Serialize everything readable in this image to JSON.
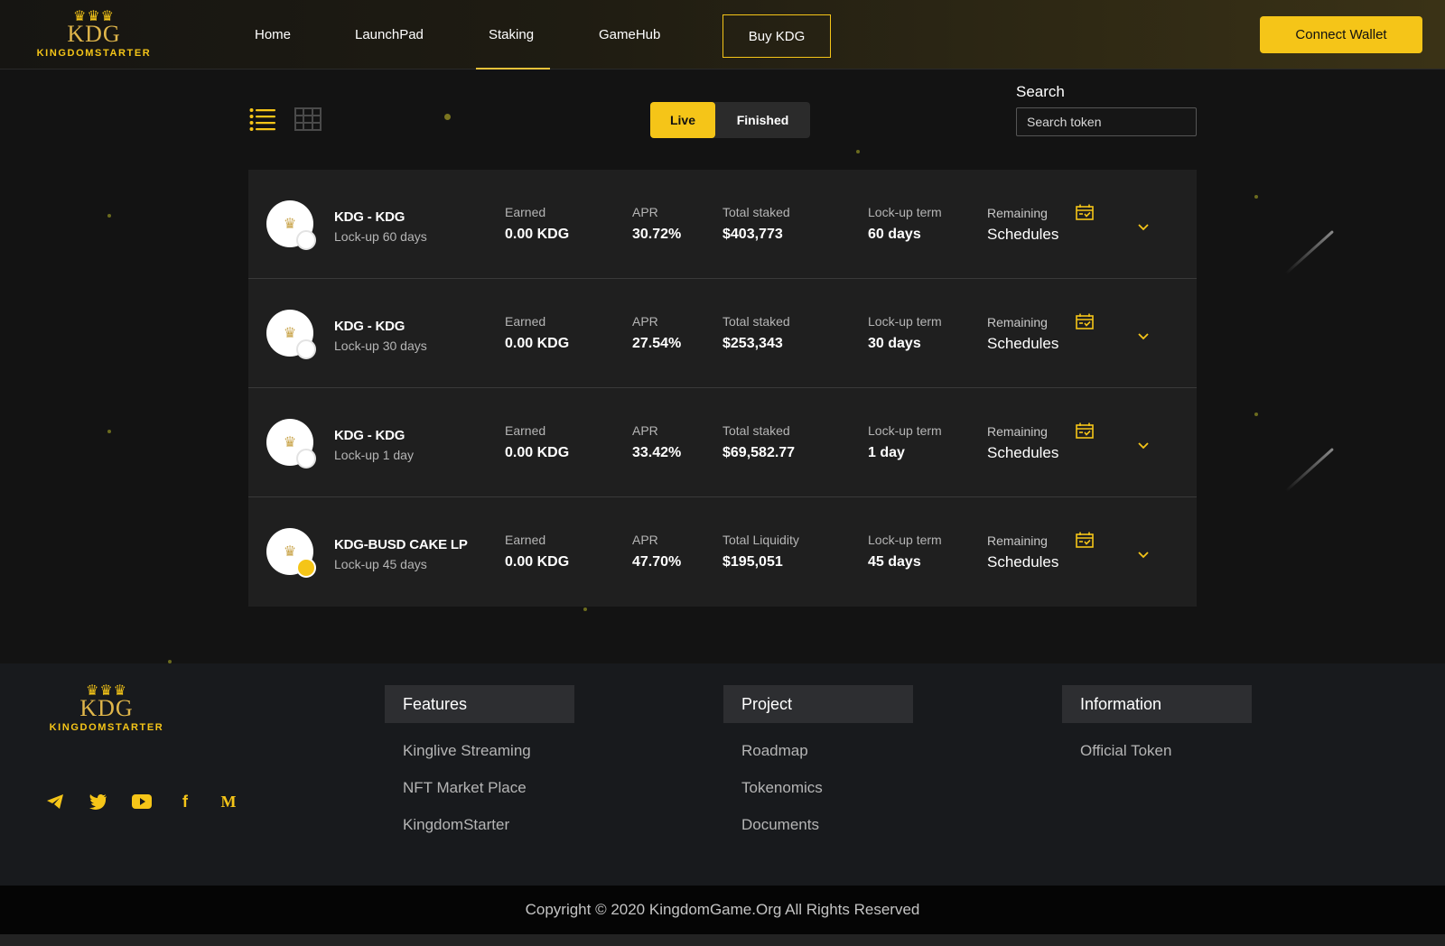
{
  "brand": {
    "logo_mark": "KDG",
    "logo_word": "KINGDOMSTARTER"
  },
  "nav": {
    "items": [
      "Home",
      "LaunchPad",
      "Staking",
      "GameHub"
    ],
    "active": "Staking",
    "buy_label": "Buy KDG",
    "connect_label": "Connect Wallet"
  },
  "toolbar": {
    "live_label": "Live",
    "finished_label": "Finished",
    "search_label": "Search",
    "search_placeholder": "Search token"
  },
  "pools": [
    {
      "name": "KDG - KDG",
      "subtitle": "Lock-up 60 days",
      "earned_label": "Earned",
      "earned_value": "0.00 KDG",
      "apr_label": "APR",
      "apr_value": "30.72%",
      "total_label": "Total staked",
      "total_value": "$403,773",
      "term_label": "Lock-up term",
      "term_value": "60 days",
      "remaining_label": "Remaining",
      "schedules_label": "Schedules"
    },
    {
      "name": "KDG - KDG",
      "subtitle": "Lock-up 30 days",
      "earned_label": "Earned",
      "earned_value": "0.00 KDG",
      "apr_label": "APR",
      "apr_value": "27.54%",
      "total_label": "Total staked",
      "total_value": "$253,343",
      "term_label": "Lock-up term",
      "term_value": "30 days",
      "remaining_label": "Remaining",
      "schedules_label": "Schedules"
    },
    {
      "name": "KDG - KDG",
      "subtitle": "Lock-up 1 day",
      "earned_label": "Earned",
      "earned_value": "0.00 KDG",
      "apr_label": "APR",
      "apr_value": "33.42%",
      "total_label": "Total staked",
      "total_value": "$69,582.77",
      "term_label": "Lock-up term",
      "term_value": "1 day",
      "remaining_label": "Remaining",
      "schedules_label": "Schedules"
    },
    {
      "name": "KDG-BUSD CAKE LP",
      "subtitle": "Lock-up 45 days",
      "earned_label": "Earned",
      "earned_value": "0.00 KDG",
      "apr_label": "APR",
      "apr_value": "47.70%",
      "total_label": "Total Liquidity",
      "total_value": "$195,051",
      "term_label": "Lock-up term",
      "term_value": "45 days",
      "remaining_label": "Remaining",
      "schedules_label": "Schedules"
    }
  ],
  "footer": {
    "features": {
      "title": "Features",
      "links": [
        "Kinglive Streaming",
        "NFT Market Place",
        "KingdomStarter"
      ]
    },
    "project": {
      "title": "Project",
      "links": [
        "Roadmap",
        "Tokenomics",
        "Documents"
      ]
    },
    "information": {
      "title": "Information",
      "links": [
        "Official Token"
      ]
    },
    "socials": [
      "telegram-icon",
      "twitter-icon",
      "youtube-icon",
      "facebook-icon",
      "medium-icon"
    ],
    "copyright": "Copyright © 2020 KingdomGame.Org All Rights Reserved"
  },
  "colors": {
    "accent": "#f5c518",
    "background": "#131313",
    "card": "#1f1f1f",
    "footer": "#181a1d"
  }
}
